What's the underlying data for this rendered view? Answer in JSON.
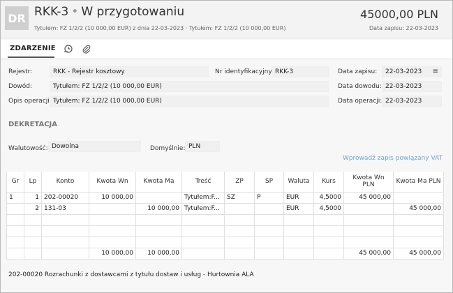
{
  "header": {
    "avatar": "DR",
    "doc_number": "RKK-3",
    "separator": "•",
    "status": "W przygotowaniu",
    "subtitle": "Tytułem: FZ 1/2/2 (10 000,00 EUR) z dnia 22-03-2023  ·  Tytułem: FZ 1/2/2 (10 000,00 EUR)",
    "amount": "45000,00 PLN",
    "entry_date": "Data zapisu: 22-03-2023"
  },
  "tabs": {
    "active": "ZDARZENIE",
    "icons": [
      "history-icon",
      "attachment-icon"
    ]
  },
  "form": {
    "rejestr_label": "Rejestr:",
    "rejestr_value": "RKK - Rejestr kosztowy",
    "nr_label": "Nr identyfikacyjny:",
    "nr_value": "RKK-3",
    "data_zapisu_label": "Data zapisu:",
    "data_zapisu_value": "22-03-2023",
    "dowod_label": "Dowód:",
    "dowod_value": "Tytułem: FZ 1/2/2 (10 000,00 EUR)",
    "data_dowodu_label": "Data dowodu:",
    "data_dowodu_value": "22-03-2023",
    "opis_label": "Opis operacji:",
    "opis_value": "Tytułem: FZ 1/2/2 (10 000,00 EUR)",
    "data_operacji_label": "Data operacji:",
    "data_operacji_value": "22-03-2023"
  },
  "dekretacja": {
    "title": "DEKRETACJA",
    "walutowosc_label": "Walutowość:",
    "walutowosc_value": "Dowolna",
    "domyslnie_label": "Domyślnie:",
    "domyslnie_value": "PLN",
    "vat_link": "Wprowadź zapis powiązany VAT"
  },
  "table": {
    "columns": [
      "Gr",
      "Lp",
      "Konto",
      "Kwota Wn",
      "Kwota Ma",
      "Treść",
      "ZP",
      "SP",
      "Waluta",
      "Kurs",
      "Kwota Wn PLN",
      "Kwota Ma PLN"
    ],
    "rows": [
      [
        "1",
        "1",
        "202-00020",
        "10 000,00",
        "",
        "Tytułem:F...",
        "SZ",
        "P",
        "EUR",
        "4,5000",
        "45 000,00",
        ""
      ],
      [
        "",
        "2",
        "131-03",
        "",
        "10 000,00",
        "Tytułem:F...",
        "",
        "",
        "EUR",
        "4,5000",
        "",
        "45 000,00"
      ]
    ],
    "empty_rows": 3,
    "totals": [
      "",
      "",
      "",
      "10 000,00",
      "10 000,00",
      "",
      "",
      "",
      "",
      "",
      "45 000,00",
      "45 000,00"
    ]
  },
  "footer": {
    "account_description": "202-00020   Rozrachunki z dostawcami z tytułu dostaw i usług - Hurtownia ALA"
  }
}
